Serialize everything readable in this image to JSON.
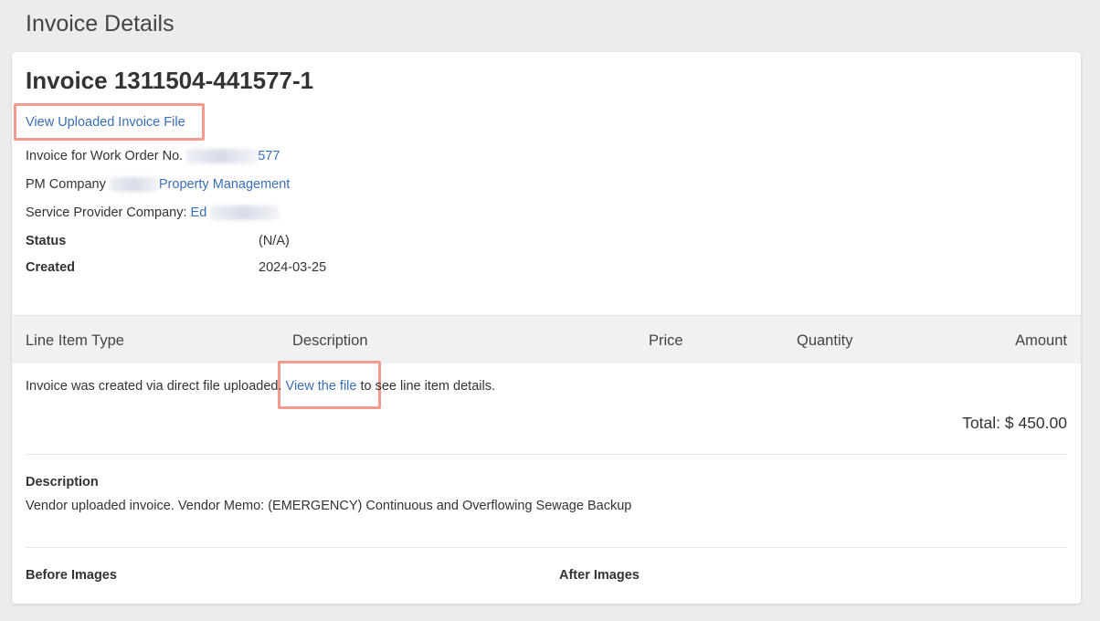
{
  "page": {
    "title": "Invoice Details"
  },
  "invoice": {
    "title": "Invoice 1311504-441577-1",
    "view_uploaded_link": "View Uploaded Invoice File",
    "work_order_label": "Invoice for Work Order No.",
    "work_order_number_visible": "577",
    "pm_company_label": "PM Company",
    "pm_company_name_visible": "Property Management",
    "service_provider_label": "Service Provider Company:",
    "service_provider_name_visible": "Ed",
    "status_label": "Status",
    "status_value": "(N/A)",
    "created_label": "Created",
    "created_value": "2024-03-25"
  },
  "line_items": {
    "headers": [
      "Line Item Type",
      "Description",
      "Price",
      "Quantity",
      "Amount"
    ],
    "note_prefix": "Invoice was created via direct file uploaded.",
    "note_link": "View the file",
    "note_suffix": "to see line item details.",
    "total": "Total: $ 450.00"
  },
  "description": {
    "label": "Description",
    "text": "Vendor uploaded invoice. Vendor Memo: (EMERGENCY) Continuous and Overflowing Sewage Backup"
  },
  "images": {
    "before_label": "Before Images",
    "after_label": "After Images"
  },
  "colors": {
    "link": "#3a6eb5",
    "highlight": "#f39b8c",
    "table_header_bg": "#f1f1f3",
    "page_bg": "#ececec"
  }
}
